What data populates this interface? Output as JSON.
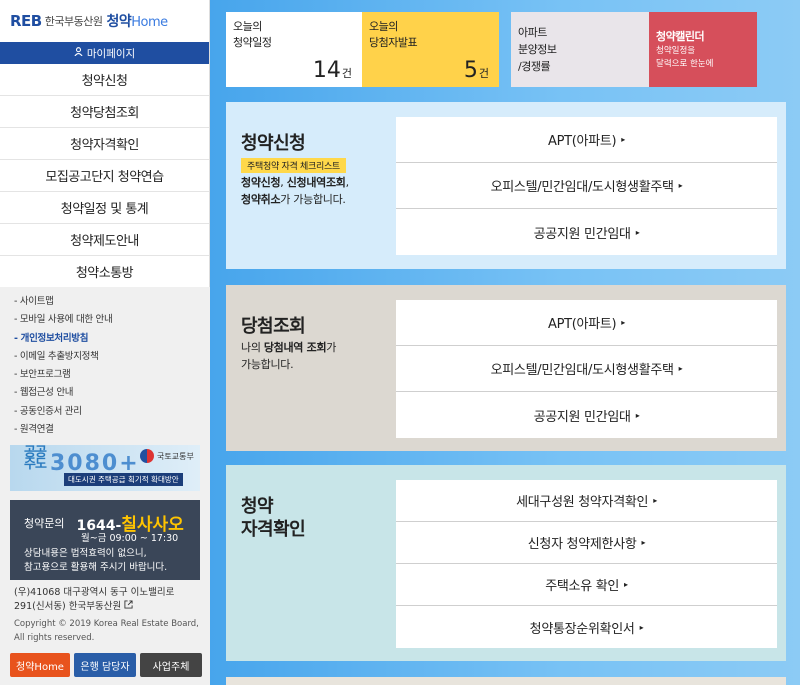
{
  "logo": {
    "mark": "REB",
    "org": "한국부동산원",
    "brand": "청약",
    "brand2": "Home"
  },
  "mypage": {
    "icon": "user-icon",
    "label": "마이페이지"
  },
  "nav": [
    "청약신청",
    "청약당첨조회",
    "청약자격확인",
    "모집공고단지 청약연습",
    "청약일정 및 통계",
    "청약제도안내",
    "청약소통방"
  ],
  "sublinks": [
    "사이트맵",
    "모바일 사용에 대한 안내",
    "개인정보처리방침",
    "이메일 추출방지정책",
    "보안프로그램",
    "웹접근성 안내",
    "공동인증서 관리",
    "원격연결"
  ],
  "banner1": {
    "title_line1": "공공",
    "title_line2": "주도",
    "number": "3080+",
    "ministry": "국토교통부",
    "caption": "대도시권 주택공급 획기적 확대방안"
  },
  "banner2": {
    "label": "청약문의",
    "phone_prefix": "1644-",
    "phone_word": "칠사사오",
    "hours": "월~금 09:00 ~ 17:30",
    "note1": "상담내용은 법적효력이 없으니,",
    "note2": "참고용으로 활용해 주시기 바랍니다."
  },
  "address": {
    "line1": "(우)41068 대구광역시 동구 이노밸리로",
    "line2": "291(신서동) 한국부동산원"
  },
  "copyright": {
    "line1": "Copyright © 2019 Korea Real Estate Board,",
    "line2": "All rights reserved."
  },
  "buttons": {
    "home": "청약Home",
    "bank": "은행 담당자",
    "biz": "사업주체"
  },
  "tiles": {
    "schedule": {
      "line1": "오늘의",
      "line2": "청약일정",
      "count": "14",
      "unit": "건"
    },
    "winners": {
      "line1": "오늘의",
      "line2": "당첨자발표",
      "count": "5",
      "unit": "건"
    },
    "apt_info": {
      "line1": "아파트",
      "line2": "분양정보",
      "line3": "/경쟁률"
    },
    "calendar": {
      "title": "청약캘린더",
      "desc1": "청약일정을",
      "desc2": "달력으로 한눈에"
    }
  },
  "sections": {
    "apply": {
      "title": "청약신청",
      "badge": "주택청약 자격 체크리스트",
      "desc_b1": "청약신청",
      "desc_t1": ", ",
      "desc_b2": "신청내역조회",
      "desc_t2": ",",
      "desc_b3": "청약취소",
      "desc_t3": "가 가능합니다.",
      "links": [
        "APT(아파트)",
        "오피스텔/민간임대/도시형생활주택",
        "공공지원 민간임대"
      ]
    },
    "result": {
      "title": "당첨조회",
      "desc_t1": "나의 ",
      "desc_b1": "당첨내역 조회",
      "desc_t2": "가",
      "desc_t3": "가능합니다.",
      "links": [
        "APT(아파트)",
        "오피스텔/민간임대/도시형생활주택",
        "공공지원 민간임대"
      ]
    },
    "eligibility": {
      "title1": "청약",
      "title2": "자격확인",
      "links": [
        "세대구성원 청약자격확인",
        "신청자 청약제한사항",
        "주택소유 확인",
        "청약통장순위확인서"
      ]
    }
  },
  "arrow": "▸"
}
